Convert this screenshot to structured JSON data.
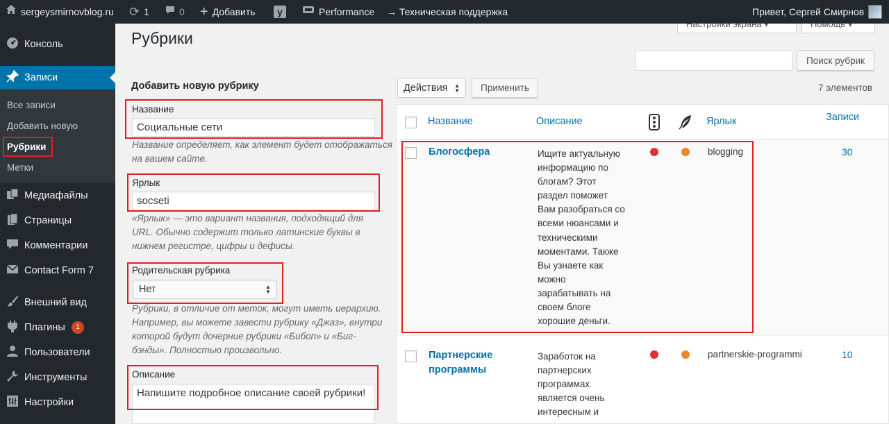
{
  "colors": {
    "adminbar": "#23282d",
    "accent": "#0073aa",
    "highlight": "#e02020",
    "dot_red": "#dc3232",
    "dot_orange": "#f0862c"
  },
  "adminbar": {
    "site": "sergeysmirnovblog.ru",
    "updates": "1",
    "comments": "0",
    "add_new": "Добавить",
    "yoast": "y",
    "performance": "Performance",
    "support": "→ Техническая поддержка",
    "greeting": "Привет, Сергей Смирнов"
  },
  "top_tabs": {
    "screen_options": "Настройки экрана ▾",
    "help": "Помощь ▾"
  },
  "sidebar": {
    "dashboard": "Консоль",
    "posts": "Записи",
    "sub": [
      "Все записи",
      "Добавить новую",
      "Рубрики",
      "Метки"
    ],
    "media": "Медиафайлы",
    "pages": "Страницы",
    "comments": "Комментарии",
    "contact": "Contact Form 7",
    "appearance": "Внешний вид",
    "plugins": "Плагины",
    "plugins_badge": "1",
    "users": "Пользователи",
    "tools": "Инструменты",
    "settings": "Настройки"
  },
  "page": {
    "title": "Рубрики",
    "form_heading": "Добавить новую рубрику",
    "name_label": "Название",
    "name_value": "Социальные сети",
    "name_hint_1": "Название определяет, как элемент будет отображаться",
    "name_hint_2": "на вашем сайте.",
    "slug_label": "Ярлык",
    "slug_value": "socseti",
    "slug_hint_1": "«Ярлык» — это вариант названия, подходящий для",
    "slug_hint_2": "URL. Обычно содержит только латинские буквы в",
    "slug_hint_3": "нижнем регистре, цифры и дефисы.",
    "parent_label": "Родительская рубрика",
    "parent_value": "Нет",
    "parent_hint_1": "Рубрики, в отличие от меток, могут иметь иерархию.",
    "parent_hint_2": "Например, вы можете завести рубрику «Джаз», внутри",
    "parent_hint_3": "которой будут дочерние рубрики «Бибоп» и «Биг-",
    "parent_hint_4": "бэнды». Полностью произвольно.",
    "desc_label": "Описание",
    "desc_value": "Напишите подробное описание своей рубрики!"
  },
  "list": {
    "search_button": "Поиск рубрик",
    "bulk_select": "Действия",
    "apply_button": "Применить",
    "count": "7 элементов",
    "columns": {
      "name": "Название",
      "description": "Описание",
      "slug": "Ярлык",
      "posts": "Записи"
    },
    "rows": [
      {
        "name": "Блогосфера",
        "desc_lines": [
          "Ищите актуальную",
          "информацию по",
          "блогам? Этот",
          "раздел поможет",
          "Вам разобраться со",
          "всеми нюансами и",
          "техническими",
          "моментами. Также",
          "Вы узнаете как",
          "можно",
          "зарабатывать на",
          "своем блоге",
          "хорошие деньги."
        ],
        "slug": "blogging",
        "posts": "30"
      },
      {
        "name_lines": [
          "Партнерские",
          "программы"
        ],
        "desc_lines": [
          "Заработок на",
          "партнерских",
          "программах",
          "является очень",
          "интересным и"
        ],
        "slug": "partnerskie-programmi",
        "posts": "10"
      }
    ]
  }
}
